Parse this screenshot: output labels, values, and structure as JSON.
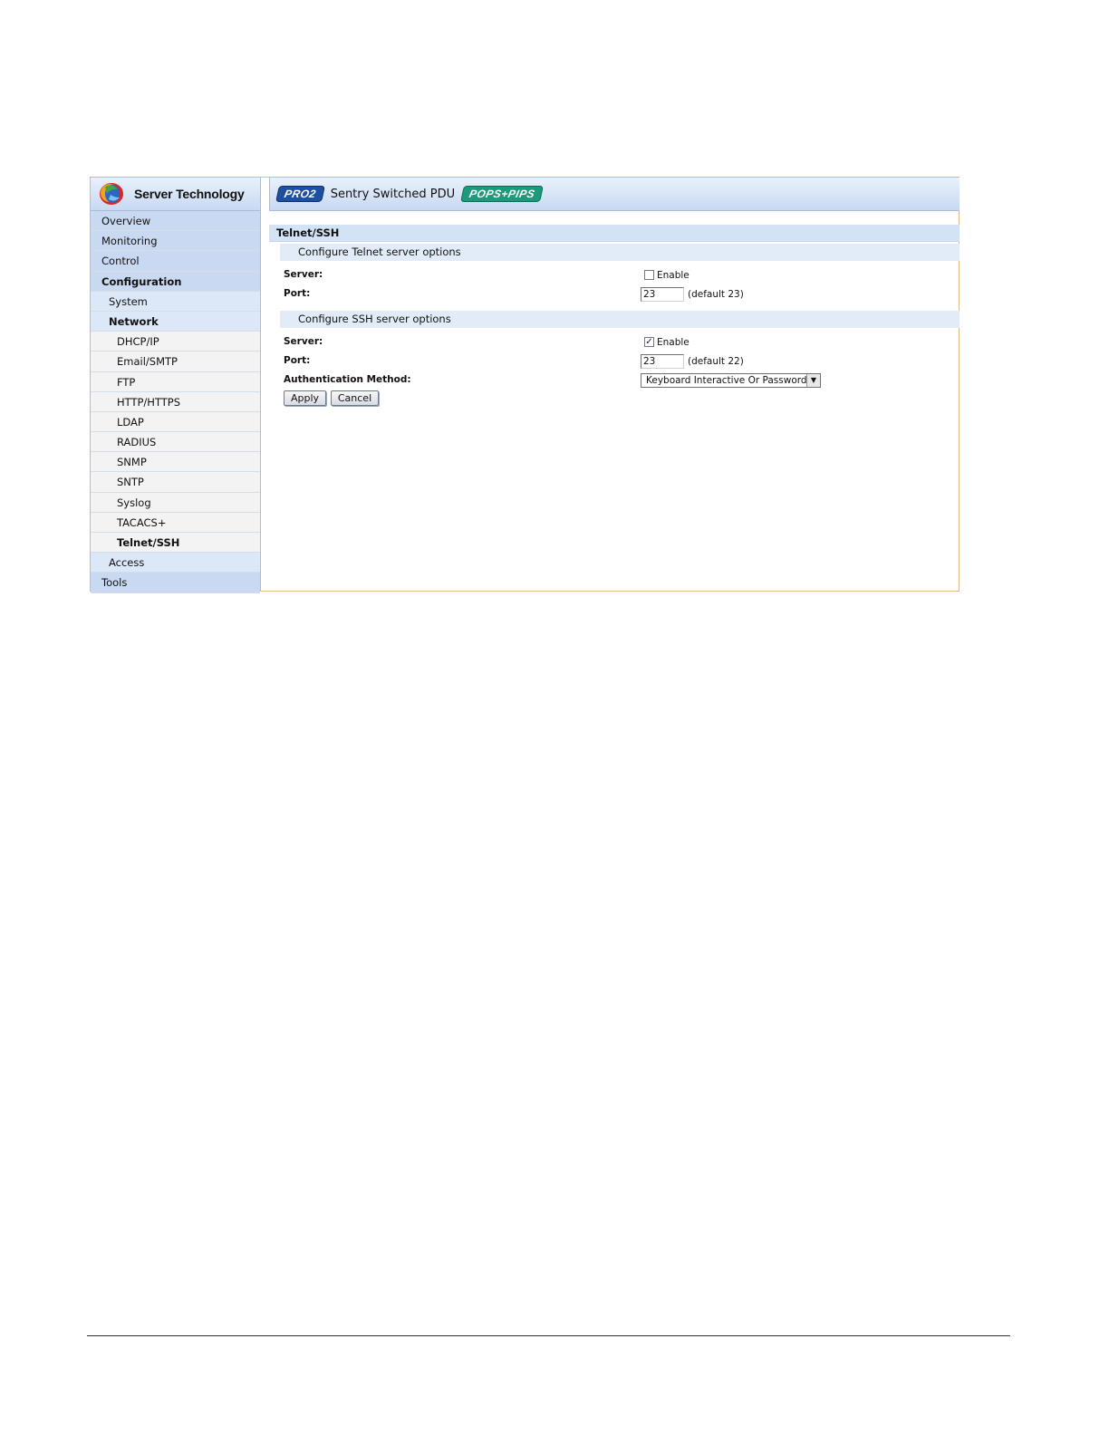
{
  "brand": {
    "name": "Server Technology"
  },
  "header": {
    "badge_pro": "PRO2",
    "product": "Sentry Switched PDU",
    "badge_pops": "POPS+PIPS"
  },
  "sidebar": {
    "items": [
      {
        "label": "Overview",
        "level": 0,
        "active": false
      },
      {
        "label": "Monitoring",
        "level": 0,
        "active": false
      },
      {
        "label": "Control",
        "level": 0,
        "active": false
      },
      {
        "label": "Configuration",
        "level": 0,
        "active": true
      },
      {
        "label": "System",
        "level": 1,
        "active": false
      },
      {
        "label": "Network",
        "level": 1,
        "active": true
      },
      {
        "label": "DHCP/IP",
        "level": 2,
        "active": false
      },
      {
        "label": "Email/SMTP",
        "level": 2,
        "active": false
      },
      {
        "label": "FTP",
        "level": 2,
        "active": false
      },
      {
        "label": "HTTP/HTTPS",
        "level": 2,
        "active": false
      },
      {
        "label": "LDAP",
        "level": 2,
        "active": false
      },
      {
        "label": "RADIUS",
        "level": 2,
        "active": false
      },
      {
        "label": "SNMP",
        "level": 2,
        "active": false
      },
      {
        "label": "SNTP",
        "level": 2,
        "active": false
      },
      {
        "label": "Syslog",
        "level": 2,
        "active": false
      },
      {
        "label": "TACACS+",
        "level": 2,
        "active": false
      },
      {
        "label": "Telnet/SSH",
        "level": 2,
        "active": true
      },
      {
        "label": "Access",
        "level": 1,
        "active": false
      },
      {
        "label": "Tools",
        "level": 0,
        "active": false
      }
    ]
  },
  "main": {
    "title": "Telnet/SSH",
    "telnet": {
      "header": "Configure Telnet server options",
      "server_label": "Server:",
      "enable_label": "Enable",
      "enabled": false,
      "port_label": "Port:",
      "port_value": "23",
      "port_default": "(default 23)"
    },
    "ssh": {
      "header": "Configure SSH server options",
      "server_label": "Server:",
      "enable_label": "Enable",
      "enabled": true,
      "port_label": "Port:",
      "port_value": "23",
      "port_default": "(default 22)",
      "auth_label": "Authentication Method:",
      "auth_value": "Keyboard Interactive Or Password"
    },
    "apply_label": "Apply",
    "cancel_label": "Cancel"
  },
  "colors": {
    "header_gradient_top": "#e9f1fc",
    "header_gradient_bottom": "#c8d9f2",
    "frame_border": "#d9b98a",
    "pro_badge": "#1d4fa3",
    "pops_badge": "#1c9a7a"
  },
  "icons": {
    "brand_logo": "globe-logo-icon",
    "checkbox_checked": "checkmark-icon",
    "dropdown": "chevron-down-icon"
  }
}
